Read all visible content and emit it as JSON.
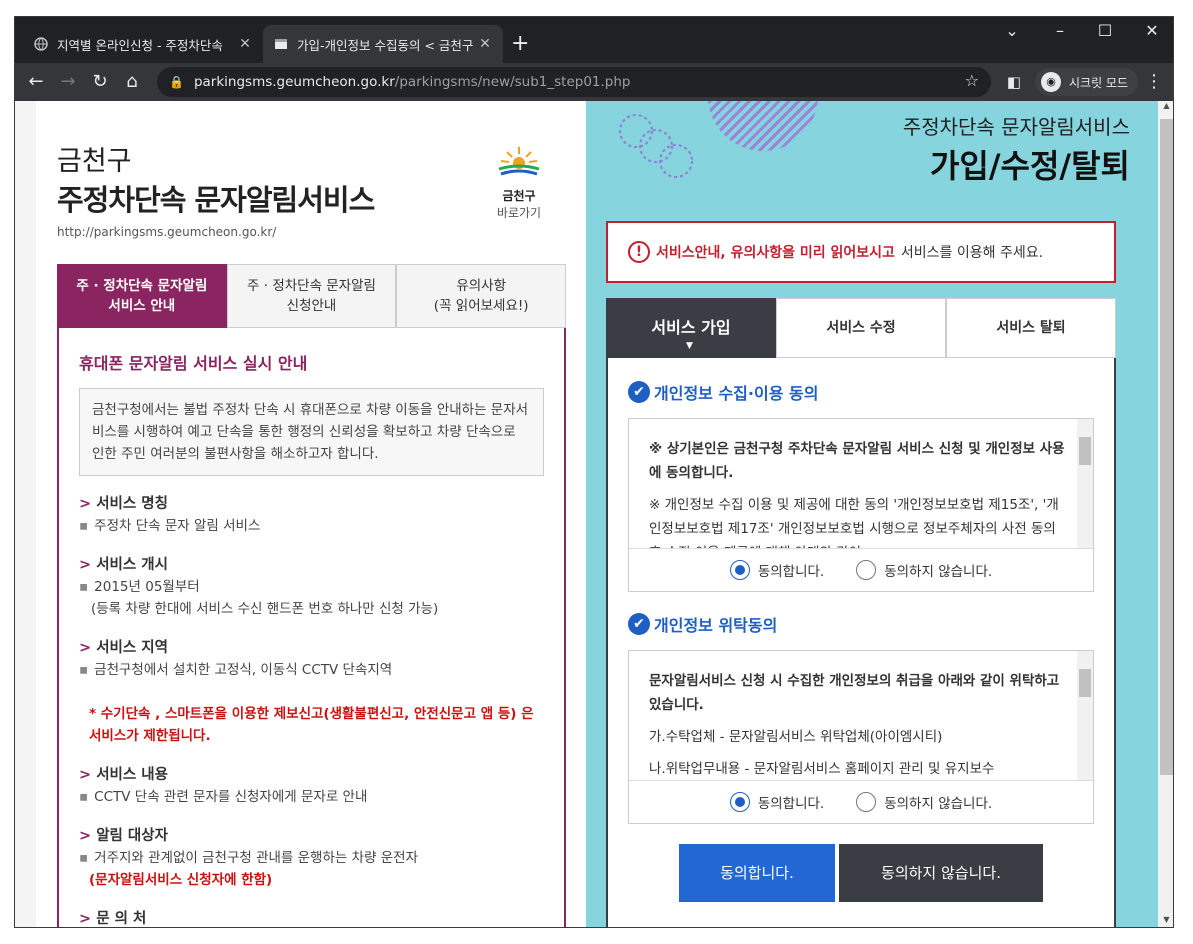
{
  "browser": {
    "tabs": [
      {
        "title": "지역별 온라인신청 - 주정차단속",
        "icon": "globe-icon"
      },
      {
        "title": "가입-개인정보 수집동의 < 금천구",
        "icon": "page-icon"
      }
    ],
    "url_host": "parkingsms.geumcheon.go.kr",
    "url_path": "/parkingsms/new/sub1_step01.php",
    "incognito_label": "시크릿 모드"
  },
  "left": {
    "title1": "금천구",
    "title2": "주정차단속 문자알림서비스",
    "url": "http://parkingsms.geumcheon.go.kr/",
    "logo_name": "금천구",
    "logo_sub": "바로가기",
    "tabs": [
      {
        "line1": "주 · 정차단속 문자알림",
        "line2": "서비스 안내"
      },
      {
        "line1": "주 · 정차단속 문자알림",
        "line2": "신청안내"
      },
      {
        "line1": "유의사항",
        "line2": "(꼭 읽어보세요!)"
      }
    ],
    "heading": "휴대폰 문자알림 서비스 실시 안내",
    "intro": "금천구청에서는 불법 주정차 단속 시 휴대폰으로 차량 이동을 안내하는 문자서비스를 시행하여 예고 단속을 통한 행정의 신뢰성을 확보하고 차량 단속으로 인한 주민 여러분의 불편사항을 해소하고자 합니다.",
    "sections": [
      {
        "title": "서비스 명칭",
        "lines": [
          "주정차 단속 문자 알림 서비스"
        ]
      },
      {
        "title": "서비스 개시",
        "lines": [
          "2015년 05월부터",
          "(등록 차량 한대에 서비스 수신 핸드폰 번호 하나만 신청 가능)"
        ]
      },
      {
        "title": "서비스 지역",
        "lines": [
          "금천구청에서 설치한 고정식, 이동식 CCTV 단속지역"
        ]
      }
    ],
    "warning": "* 수기단속 , 스마트폰을 이용한 제보신고(생활불편신고, 안전신문고 앱 등) 은 서비스가 제한됩니다.",
    "sections2": [
      {
        "title": "서비스 내용",
        "lines": [
          "CCTV 단속 관련 문자를 신청자에게 문자로 안내"
        ]
      },
      {
        "title": "알림 대상자",
        "lines": [
          "거주지와 관계없이 금천구청 관내를 운행하는 차량 운전자"
        ],
        "note": "(문자알림서비스 신청자에 한함)"
      },
      {
        "title": "문 의 처",
        "lines": []
      }
    ]
  },
  "right": {
    "title1": "주정차단속 문자알림서비스",
    "title2": "가입/수정/탈퇴",
    "notice_bold": "서비스안내, 유의사항을 미리 읽어보시고",
    "notice_rest": "서비스를 이용해 주세요.",
    "tabs": [
      "서비스 가입",
      "서비스 수정",
      "서비스 탈퇴"
    ],
    "agreements": [
      {
        "title": "개인정보 수집·이용 동의",
        "strong": "※ 상기본인은 금천구청 주차단속 문자알림 서비스 신청 및 개인정보 사용에 동의합니다.",
        "text": "※ 개인정보 수집 이용 및 제공에 대한 동의 '개인정보보호법 제15조', '개인정보보호법 제17조' 개인정보보호법 시행으로 정보주체자의 사전 동의 후 수집 이용 제공에 대해 아래와 같이",
        "agree": "동의합니다.",
        "disagree": "동의하지 않습니다."
      },
      {
        "title": "개인정보 위탁동의",
        "strong": "문자알림서비스 신청 시 수집한 개인정보의 취급을 아래와 같이 위탁하고 있습니다.",
        "text": "가.수탁업체 - 문자알림서비스 위탁업체(아이엠시티)",
        "text2": "나.위탁업무내용 - 문자알림서비스 홈페이지 관리 및 유지보수",
        "agree": "동의합니다.",
        "disagree": "동의하지 않습니다."
      }
    ],
    "btn_agree": "동의합니다.",
    "btn_disagree": "동의하지 않습니다."
  }
}
